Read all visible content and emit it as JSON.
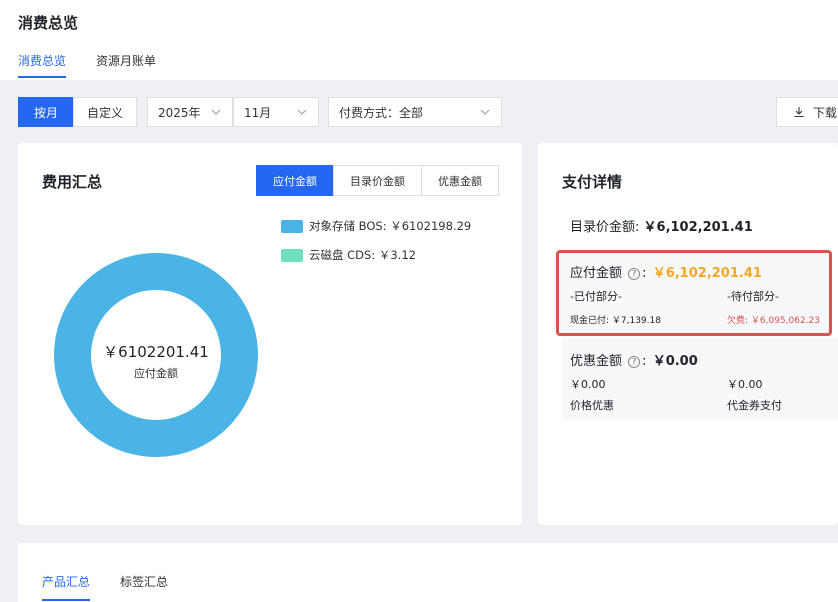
{
  "header": {
    "title": "消费总览",
    "tabs": [
      {
        "label": "消费总览",
        "active": true
      },
      {
        "label": "资源月账单",
        "active": false
      }
    ]
  },
  "filters": {
    "by_month": "按月",
    "custom": "自定义",
    "year": "2025年",
    "month": "11月",
    "payment_method": "付费方式：全部",
    "download": "下载"
  },
  "cost_summary": {
    "title": "费用汇总",
    "segments": [
      {
        "label": "应付金额",
        "active": true
      },
      {
        "label": "目录价金额",
        "active": false
      },
      {
        "label": "优惠金额",
        "active": false
      }
    ],
    "legend": [
      {
        "label": "对象存储 BOS: ￥6102198.29",
        "color": "#4bb4e6",
        "value": 6102198.29
      },
      {
        "label": "云磁盘 CDS: ￥3.12",
        "color": "#6fe0bf",
        "value": 3.12
      }
    ],
    "donut_amount": "￥6102201.41",
    "donut_label": "应付金额"
  },
  "payment_details": {
    "title": "支付详情",
    "list_price_label": "目录价金额:",
    "list_price_value": "￥6,102,201.41",
    "payable_label": "应付金额",
    "payable_value": "￥6,102,201.41",
    "paid_part": "-已付部分-",
    "pending_part": "-待付部分-",
    "cash_paid": "现金已付: ￥7,139.18",
    "owed": "欠费: ￥6,095,062.23",
    "discount_label": "优惠金额",
    "discount_value": "￥0.00",
    "price_discount_value": "￥0.00",
    "price_discount_label": "价格优惠",
    "voucher_value": "￥0.00",
    "voucher_label": "代金券支付"
  },
  "bottom_tabs": [
    {
      "label": "产品汇总",
      "active": true
    },
    {
      "label": "标签汇总",
      "active": false
    }
  ],
  "colors": {
    "accent": "#2468f2",
    "warning": "#f5a623",
    "danger": "#d9534f"
  }
}
